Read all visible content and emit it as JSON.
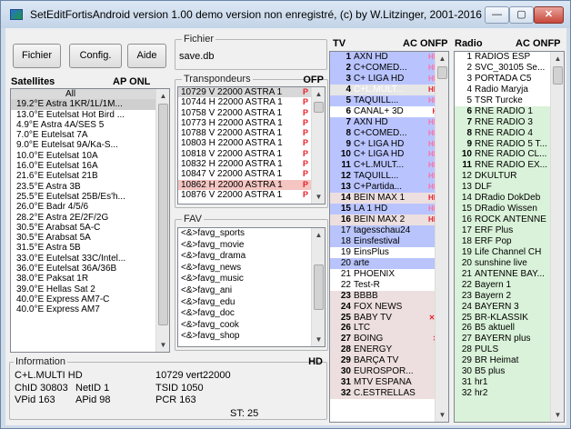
{
  "window": {
    "title": "SetEditFortisAndroid version  1.00  demo version non enregistré, (c) by W.Litzinger, 2001-2016",
    "min_glyph": "—",
    "max_glyph": "▢",
    "close_glyph": "✕"
  },
  "toolbar": {
    "file_label": "Fichier",
    "config_label": "Config.",
    "help_label": "Aide",
    "file_group_title": "Fichier",
    "file_name": "save.db"
  },
  "satellites": {
    "title": "Satellites",
    "flags": "AP ONL",
    "items": [
      "All",
      "19.2°E Astra 1KR/1L/1M...",
      "13.0°E Eutelsat Hot Bird ...",
      "4.9°E Astra 4A/SES 5",
      "7.0°E Eutelsat 7A",
      "9.0°E Eutelsat 9A/Ka-S...",
      "10.0°E Eutelsat 10A",
      "16.0°E Eutelsat 16A",
      "21.6°E Eutelsat 21B",
      "23.5°E Astra 3B",
      "25.5°E Eutelsat 25B/Es'h...",
      "26.0°E Badr 4/5/6",
      "28.2°E Astra 2E/2F/2G",
      "30.5°E Arabsat 5A-C",
      "30.5°E Arabsat 5A",
      "31.5°E Astra 5B",
      "33.0°E Eutelsat 33C/Intel...",
      "36.0°E Eutelsat 36A/36B",
      "38.0°E Paksat 1R",
      "39.0°E Hellas Sat 2",
      "40.0°E Express AM7-C",
      "40.0°E Express AM7"
    ],
    "selected_index": 1
  },
  "transponders": {
    "title": "Transpondeurs",
    "flags": "OFP",
    "items": [
      "10729 V 22000 ASTRA 1",
      "10744 H 22000 ASTRA 1",
      "10758 V 22000 ASTRA 1",
      "10773 H 22000 ASTRA 1",
      "10788 V 22000 ASTRA 1",
      "10803 H 22000 ASTRA 1",
      "10818 V 22000 ASTRA 1",
      "10832 H 22000 ASTRA 1",
      "10847 V 22000 ASTRA 1",
      "10862 H 22000 ASTRA 1",
      "10876 V 22000 ASTRA 1"
    ],
    "tag": "P"
  },
  "fav": {
    "title": "FAV",
    "items": [
      "<&>favg_sports",
      "<&>favg_movie",
      "<&>favg_drama",
      "<&>favg_news",
      "<&>favg_music",
      "<&>favg_ani",
      "<&>favg_edu",
      "<&>favg_doc",
      "<&>favg_cook",
      "<&>favg_shop"
    ]
  },
  "information": {
    "title": "Information",
    "tag": "HD",
    "channel": "C+L.MULTI HD",
    "freq": "10729  vert22000",
    "chid": "ChID 30803",
    "netid": "NetID 1",
    "tsid": "TSID 1050",
    "vpid": "VPid 163",
    "apid": "APid 98",
    "pcr": "PCR 163",
    "st": "ST: 25"
  },
  "tv": {
    "title": "TV",
    "flags": "AC ONFP",
    "channels": [
      {
        "num": "1",
        "name": "AXN HD",
        "tag": "HD$",
        "style": "hd"
      },
      {
        "num": "2",
        "name": "C+COMED...",
        "tag": "HD$",
        "style": "hd"
      },
      {
        "num": "3",
        "name": "C+ LIGA HD",
        "tag": "HD$",
        "style": "hd"
      },
      {
        "num": "4",
        "name": "C+L.MULT...",
        "tag": "HD$",
        "style": "sd"
      },
      {
        "num": "5",
        "name": "TAQUILL...",
        "tag": "HD$",
        "style": "hd"
      },
      {
        "num": "6",
        "name": "CANAL+ 3D",
        "tag": "HD",
        "style": "hdwhite"
      },
      {
        "num": "7",
        "name": "AXN HD",
        "tag": "HD$",
        "style": "hd"
      },
      {
        "num": "8",
        "name": "C+COMED...",
        "tag": "HD$",
        "style": "hd"
      },
      {
        "num": "9",
        "name": "C+ LIGA HD",
        "tag": "HD$",
        "style": "hd"
      },
      {
        "num": "10",
        "name": "C+ LIGA HD",
        "tag": "HD$",
        "style": "hd"
      },
      {
        "num": "11",
        "name": "C+L.MULT...",
        "tag": "HD$",
        "style": "hd"
      },
      {
        "num": "12",
        "name": "TAQUILL...",
        "tag": "HD$",
        "style": "hd"
      },
      {
        "num": "13",
        "name": "C+Partida...",
        "tag": "HD$",
        "style": "hd"
      },
      {
        "num": "14",
        "name": "BEIN MAX 1",
        "tag": "HD$",
        "style": "pk"
      },
      {
        "num": "15",
        "name": "LA 1 HD",
        "tag": "HD$",
        "style": "hd"
      },
      {
        "num": "16",
        "name": "BEIN MAX 2",
        "tag": "HD$",
        "style": "pk"
      },
      {
        "num": "17",
        "name": "tagesschau24",
        "tag": "",
        "style": "lbl"
      },
      {
        "num": "18",
        "name": "Einsfestival",
        "tag": "",
        "style": "lbl"
      },
      {
        "num": "19",
        "name": "EinsPlus",
        "tag": "",
        "style": "white"
      },
      {
        "num": "20",
        "name": "arte",
        "tag": "",
        "style": "lbl"
      },
      {
        "num": "21",
        "name": "PHOENIX",
        "tag": "",
        "style": "white"
      },
      {
        "num": "22",
        "name": "Test-R",
        "tag": "",
        "style": "white"
      },
      {
        "num": "23",
        "name": "BBBB",
        "tag": "$ꞩ",
        "style": "pk"
      },
      {
        "num": "24",
        "name": "FOX NEWS",
        "tag": "$",
        "style": "pk"
      },
      {
        "num": "25",
        "name": "BABY TV",
        "tag": "✕$ꞩ",
        "style": "pk"
      },
      {
        "num": "26",
        "name": "LTC",
        "tag": "",
        "style": "pk"
      },
      {
        "num": "27",
        "name": "BOING",
        "tag": "✕$",
        "style": "pk"
      },
      {
        "num": "28",
        "name": "ENERGY",
        "tag": "$",
        "style": "pk"
      },
      {
        "num": "29",
        "name": "BARÇA TV",
        "tag": "$ꞩ",
        "style": "pk"
      },
      {
        "num": "30",
        "name": "EUROSPOR...",
        "tag": "$",
        "style": "pk"
      },
      {
        "num": "31",
        "name": "MTV ESPAÑA",
        "tag": "$",
        "style": "pk"
      },
      {
        "num": "32",
        "name": "C.ESTRELLAS",
        "tag": "$",
        "style": "pk"
      }
    ]
  },
  "radio": {
    "title": "Radio",
    "flags": "AC ONFP",
    "channels": [
      {
        "num": "1",
        "name": "RADIOS ESP",
        "style": "wh"
      },
      {
        "num": "2",
        "name": "SVC_30105 Se...",
        "style": "wh"
      },
      {
        "num": "3",
        "name": "PORTADA C5",
        "style": "wh"
      },
      {
        "num": "4",
        "name": "Radio Maryja",
        "style": "wh"
      },
      {
        "num": "5",
        "name": "TSR Turcke",
        "style": "wh"
      },
      {
        "num": "6",
        "name": "RNE RADIO 1",
        "style": "bold"
      },
      {
        "num": "7",
        "name": "RNE RADIO 3",
        "style": "bold"
      },
      {
        "num": "8",
        "name": "RNE RADIO 4",
        "style": "bold"
      },
      {
        "num": "9",
        "name": "RNE RADIO 5 T...",
        "style": "bold"
      },
      {
        "num": "10",
        "name": "RNE RADIO CL...",
        "style": "bold"
      },
      {
        "num": "11",
        "name": "RNE RADIO EX...",
        "style": "bold"
      },
      {
        "num": "12",
        "name": "DKULTUR",
        "style": ""
      },
      {
        "num": "13",
        "name": "DLF",
        "style": ""
      },
      {
        "num": "14",
        "name": "DRadio DokDeb",
        "style": ""
      },
      {
        "num": "15",
        "name": "DRadio Wissen",
        "style": ""
      },
      {
        "num": "16",
        "name": "ROCK ANTENNE",
        "style": ""
      },
      {
        "num": "17",
        "name": "ERF Plus",
        "style": ""
      },
      {
        "num": "18",
        "name": "ERF Pop",
        "style": ""
      },
      {
        "num": "19",
        "name": "Life Channel CH",
        "style": ""
      },
      {
        "num": "20",
        "name": "sunshine live",
        "style": ""
      },
      {
        "num": "21",
        "name": "ANTENNE BAY...",
        "style": ""
      },
      {
        "num": "22",
        "name": "Bayern 1",
        "style": ""
      },
      {
        "num": "23",
        "name": "Bayern 2",
        "style": ""
      },
      {
        "num": "24",
        "name": "BAYERN 3",
        "style": ""
      },
      {
        "num": "25",
        "name": "BR-KLASSIK",
        "style": ""
      },
      {
        "num": "26",
        "name": "B5 aktuell",
        "style": ""
      },
      {
        "num": "27",
        "name": "BAYERN plus",
        "style": ""
      },
      {
        "num": "28",
        "name": "PULS",
        "style": ""
      },
      {
        "num": "29",
        "name": "BR Heimat",
        "style": ""
      },
      {
        "num": "30",
        "name": "B5 plus",
        "style": ""
      },
      {
        "num": "31",
        "name": "hr1",
        "style": ""
      },
      {
        "num": "32",
        "name": "hr2",
        "style": ""
      }
    ]
  },
  "colors": {
    "hd_row": "#b9c4ff",
    "pay_row": "#eddfdf",
    "radio_bg": "#d9f2d9",
    "tag_red": "#e8202a",
    "tag_pink": "#ff70a6"
  }
}
